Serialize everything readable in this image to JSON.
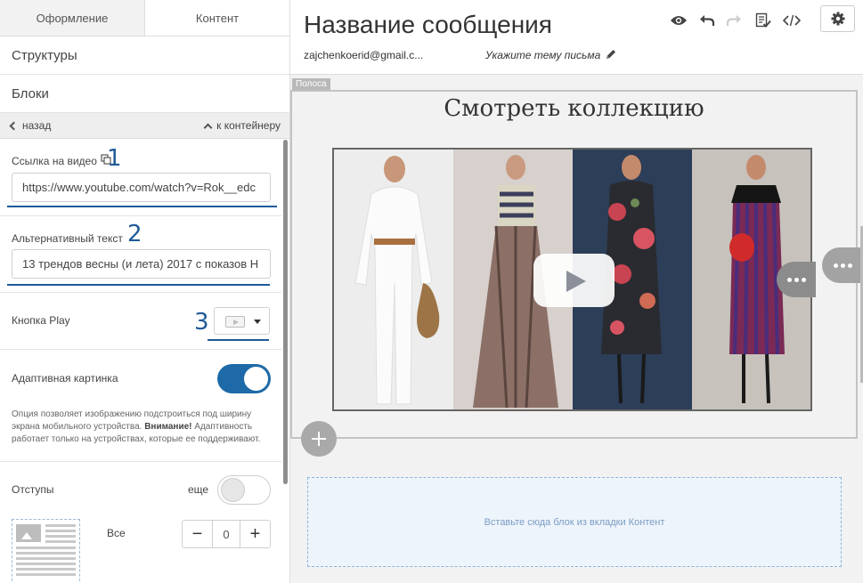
{
  "sidebar": {
    "tabs": [
      {
        "label": "Оформление"
      },
      {
        "label": "Контент"
      }
    ],
    "menu": [
      {
        "label": "Структуры"
      },
      {
        "label": "Блоки"
      }
    ],
    "nav": {
      "back_label": "назад",
      "container_label": "к контейнеру"
    },
    "video_link": {
      "label": "Ссылка на видео",
      "value": "https://www.youtube.com/watch?v=Rok__edc",
      "annotation": "1"
    },
    "alt_text": {
      "label": "Альтернативный текст",
      "value": "13 трендов весны (и лета) 2017 с показов Н",
      "annotation": "2"
    },
    "play_button": {
      "label": "Кнопка Play",
      "annotation": "3"
    },
    "adaptive": {
      "label": "Адаптивная картинка",
      "enabled": true,
      "hint_text": "Опция позволяет изображению подстроиться под ширину экрана мобильного устройства.",
      "hint_bold": "Внимание!",
      "hint_rest": "Адаптивность работает только на устройствах, которые ее поддерживают."
    },
    "padding": {
      "label": "Отступы",
      "more_label": "еще",
      "more_enabled": false,
      "all_label": "Все",
      "value": "0",
      "minus": "−",
      "plus": "+"
    }
  },
  "header": {
    "title": "Название сообщения",
    "email": "zajchenkoerid@gmail.c...",
    "subject_placeholder": "Укажите тему письма"
  },
  "canvas": {
    "stripe_label": "Полоса",
    "block_title": "Смотреть коллекцию",
    "drop_zone_text": "Вставьте сюда блок из вкладки Контент"
  },
  "colors": {
    "accent": "#1e6aa8",
    "annotation": "#1f5a96"
  }
}
